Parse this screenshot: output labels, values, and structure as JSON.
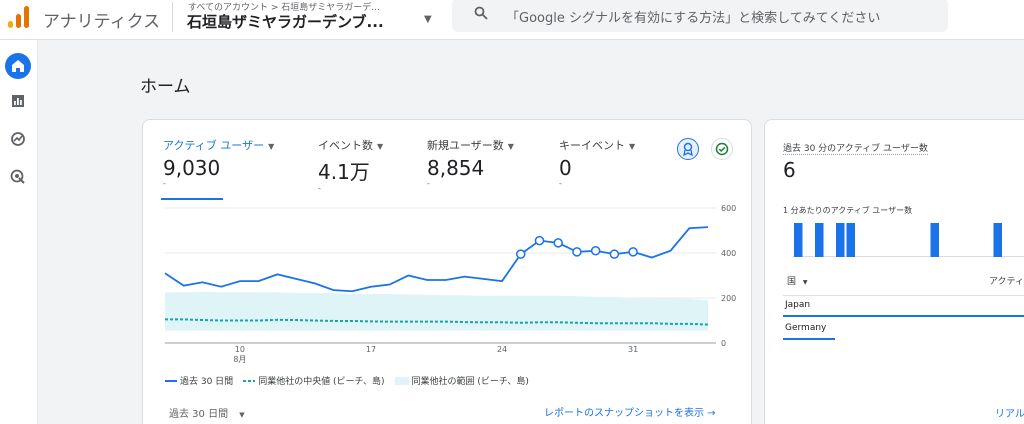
{
  "topbar": {
    "app_title": "アナリティクス",
    "breadcrumb": "すべてのアカウント > 石垣島ザミヤラガーデ...",
    "property": "石垣島ザミヤラガーデンブ...",
    "search_placeholder": "「Google シグナルを有効にする方法」と検索してみてください"
  },
  "rail": {
    "items": [
      "home-icon",
      "reports-icon",
      "explore-icon",
      "advertising-icon"
    ]
  },
  "page": {
    "title": "ホーム"
  },
  "overview": {
    "metrics": [
      {
        "label": "アクティブ ユーザー",
        "value": "9,030",
        "tick": "-"
      },
      {
        "label": "イベント数",
        "value": "4.1万",
        "tick": "-"
      },
      {
        "label": "新規ユーザー数",
        "value": "8,854",
        "tick": "-"
      },
      {
        "label": "キーイベント",
        "value": "0",
        "tick": "-"
      }
    ],
    "legend": {
      "current": "過去 30 日間",
      "median": "同業他社の中央値 (ビーチ、島)",
      "range": "同業他社の範囲 (ビーチ、島)"
    },
    "date_range": "過去 30 日間",
    "report_link": "レポートのスナップショットを表示 →"
  },
  "chart_data": {
    "type": "line",
    "x_tick_labels": [
      "10",
      "8月",
      "17",
      "24",
      "31"
    ],
    "ylim": [
      0,
      600
    ],
    "y_ticks": [
      "600",
      "400",
      "200",
      "0"
    ],
    "series": [
      {
        "name": "過去 30 日間",
        "values": [
          310,
          255,
          270,
          250,
          275,
          275,
          305,
          285,
          265,
          235,
          230,
          250,
          260,
          300,
          280,
          280,
          295,
          285,
          275,
          395,
          455,
          445,
          405,
          410,
          395,
          405,
          380,
          410,
          510,
          515
        ],
        "marker_indices": [
          19,
          20,
          21,
          22,
          23,
          24,
          25
        ]
      },
      {
        "name": "同業他社の中央値 (ビーチ、島)",
        "values": [
          105,
          105,
          102,
          100,
          100,
          100,
          103,
          102,
          100,
          98,
          98,
          96,
          95,
          95,
          95,
          95,
          93,
          92,
          92,
          90,
          92,
          92,
          90,
          88,
          88,
          88,
          88,
          85,
          85,
          82
        ]
      },
      {
        "name": "同業他社の範囲 (ビーチ、島)",
        "upper": [
          225,
          225,
          228,
          225,
          225,
          225,
          225,
          222,
          222,
          222,
          218,
          218,
          218,
          215,
          215,
          212,
          212,
          210,
          210,
          210,
          210,
          210,
          208,
          205,
          205,
          200,
          200,
          198,
          195,
          190
        ],
        "lower": [
          55,
          55,
          55,
          55,
          55,
          55,
          55,
          55,
          55,
          55,
          55,
          55,
          55,
          55,
          55,
          55,
          55,
          55,
          55,
          55,
          55,
          55,
          55,
          55,
          55,
          55,
          55,
          55,
          55,
          55
        ]
      }
    ],
    "colors": {
      "current": "#1a73e8",
      "median": "#12a4af",
      "range": "#dff4f6"
    }
  },
  "realtime": {
    "title": "過去 30 分のアクティブ ユーザー数",
    "value": "6",
    "per_minute_label": "1 分あたりのアクティブ ユーザー数",
    "per_minute_values": [
      1,
      0,
      1,
      0,
      1,
      1,
      0,
      0,
      0,
      0,
      0,
      0,
      0,
      1,
      0,
      0,
      0,
      0,
      0,
      1,
      0,
      0,
      0,
      0
    ],
    "country_header": "国",
    "users_header": "アクティ",
    "rows": [
      {
        "country": "Japan",
        "share": 1.0
      },
      {
        "country": "Germany",
        "share": 0.2
      }
    ],
    "link": "リアル"
  }
}
